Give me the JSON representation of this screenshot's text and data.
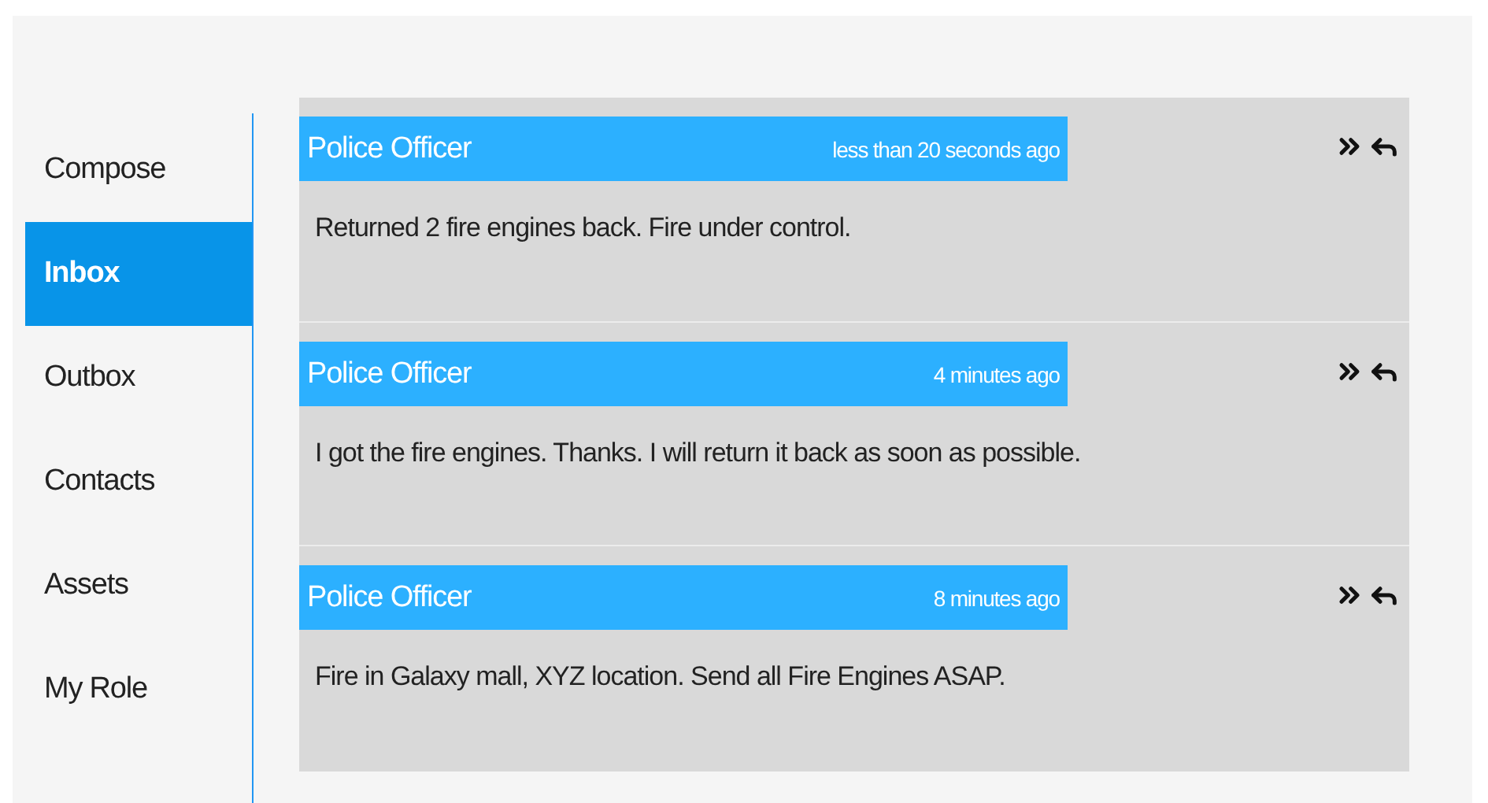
{
  "sidebar": {
    "items": [
      {
        "label": "Compose",
        "selected": false
      },
      {
        "label": "Inbox",
        "selected": true
      },
      {
        "label": "Outbox",
        "selected": false
      },
      {
        "label": "Contacts",
        "selected": false
      },
      {
        "label": "Assets",
        "selected": false
      },
      {
        "label": "My Role",
        "selected": false
      }
    ]
  },
  "messages": [
    {
      "sender": "Police Officer",
      "time": "less than 20 seconds ago",
      "body": "Returned 2 fire engines back. Fire under control."
    },
    {
      "sender": "Police Officer",
      "time": "4 minutes ago",
      "body": "I got the fire engines. Thanks. I will return it back as soon as possible."
    },
    {
      "sender": "Police Officer",
      "time": "8 minutes ago",
      "body": "Fire in Galaxy mall, XYZ location. Send all Fire Engines ASAP."
    }
  ]
}
